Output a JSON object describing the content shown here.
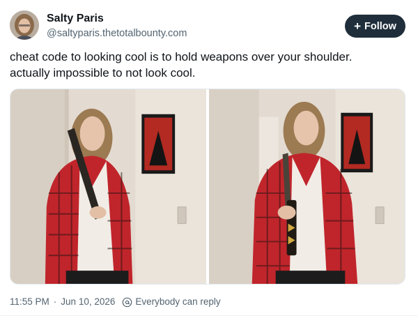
{
  "author": {
    "name": "Salty Paris",
    "handle": "@saltyparis.thetotalbounty.com"
  },
  "follow_button": {
    "icon": "plus-icon",
    "label": "Follow"
  },
  "post": {
    "lines": [
      "cheat code to looking cool is to hold weapons over your shoulder.",
      "actually impossible to not look cool."
    ]
  },
  "media": {
    "count": 2
  },
  "footer": {
    "time": "11:55 PM",
    "separator": "·",
    "date": "Jun 10, 2026",
    "reply_setting_icon": "at-sign-icon",
    "reply_setting": "Everybody can reply"
  },
  "colors": {
    "follow_bg": "#1f2e3a",
    "secondary_text": "#536471",
    "primary_text": "#0f1419",
    "shirt_red": "#c0252b",
    "wall": "#e7dfd5"
  }
}
